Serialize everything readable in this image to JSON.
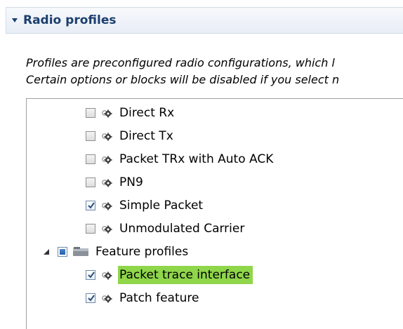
{
  "section": {
    "title": "Radio profiles",
    "expanded": true
  },
  "description": {
    "line1": "Profiles are preconfigured radio configurations, which l",
    "line2": "Certain options or blocks will be disabled if you select n"
  },
  "tree": {
    "items": [
      {
        "label": "Direct Rx",
        "checked": false,
        "icon": "gear-icon"
      },
      {
        "label": "Direct Tx",
        "checked": false,
        "icon": "gear-icon"
      },
      {
        "label": "Packet TRx with Auto ACK",
        "checked": false,
        "icon": "gear-icon"
      },
      {
        "label": "PN9",
        "checked": false,
        "icon": "gear-icon"
      },
      {
        "label": "Simple Packet",
        "checked": true,
        "icon": "gear-icon"
      },
      {
        "label": "Unmodulated Carrier",
        "checked": false,
        "icon": "gear-icon"
      }
    ],
    "group": {
      "label": "Feature profiles",
      "expanded": true,
      "state": "partial",
      "icon": "folder-icon",
      "children": [
        {
          "label": "Packet trace interface",
          "checked": true,
          "selected": true,
          "icon": "gear-icon"
        },
        {
          "label": "Patch feature",
          "checked": true,
          "icon": "gear-icon"
        }
      ]
    }
  },
  "colors": {
    "header_title": "#1c3f6e",
    "selection_highlight": "#8fd64a",
    "tree_border": "#a0a0a0"
  }
}
